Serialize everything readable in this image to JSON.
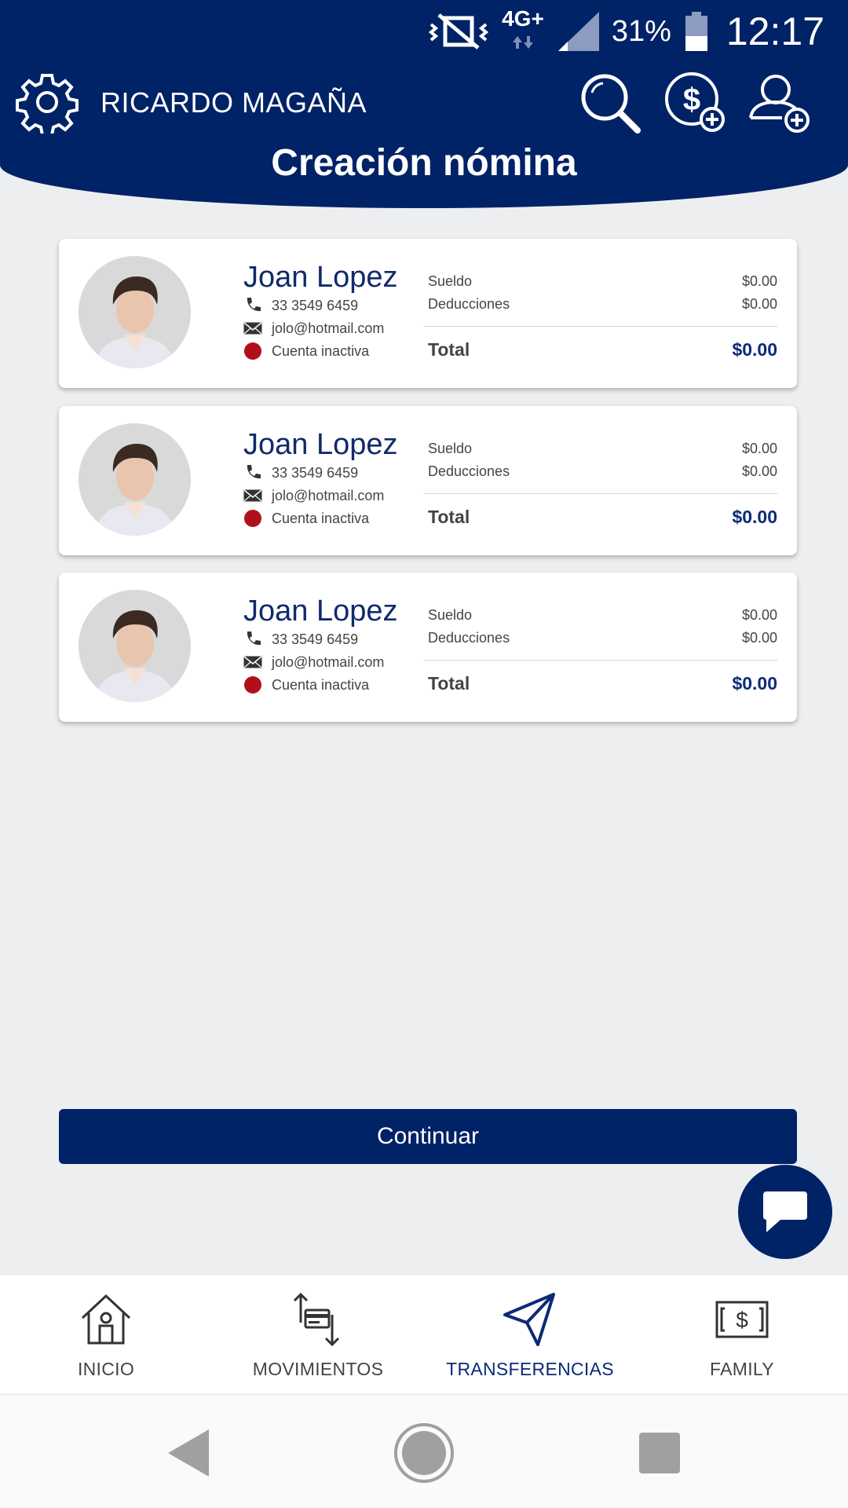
{
  "status_bar": {
    "network": "4G+",
    "battery": "31%",
    "time": "12:17"
  },
  "header": {
    "user_name": "RICARDO MAGAÑA",
    "title": "Creación nómina"
  },
  "employees": [
    {
      "name": "Joan Lopez",
      "phone": "33 3549 6459",
      "email": "jolo@hotmail.com",
      "status": "Cuenta inactiva",
      "salary_label": "Sueldo",
      "salary": "$0.00",
      "deductions_label": "Deducciones",
      "deductions": "$0.00",
      "total_label": "Total",
      "total": "$0.00"
    },
    {
      "name": "Joan Lopez",
      "phone": "33 3549 6459",
      "email": "jolo@hotmail.com",
      "status": "Cuenta inactiva",
      "salary_label": "Sueldo",
      "salary": "$0.00",
      "deductions_label": "Deducciones",
      "deductions": "$0.00",
      "total_label": "Total",
      "total": "$0.00"
    },
    {
      "name": "Joan Lopez",
      "phone": "33 3549 6459",
      "email": "jolo@hotmail.com",
      "status": "Cuenta inactiva",
      "salary_label": "Sueldo",
      "salary": "$0.00",
      "deductions_label": "Deducciones",
      "deductions": "$0.00",
      "total_label": "Total",
      "total": "$0.00"
    }
  ],
  "actions": {
    "continue_label": "Continuar"
  },
  "bottom_nav": {
    "items": [
      {
        "label": "INICIO",
        "icon": "home-icon",
        "active": false
      },
      {
        "label": "MOVIMIENTOS",
        "icon": "movements-icon",
        "active": false
      },
      {
        "label": "TRANSFERENCIAS",
        "icon": "send-icon",
        "active": true
      },
      {
        "label": "FAMILY",
        "icon": "money-bill-icon",
        "active": false
      }
    ]
  },
  "colors": {
    "brand_navy": "#002266",
    "inactive_status": "#b0101a",
    "background": "#edeef0"
  }
}
